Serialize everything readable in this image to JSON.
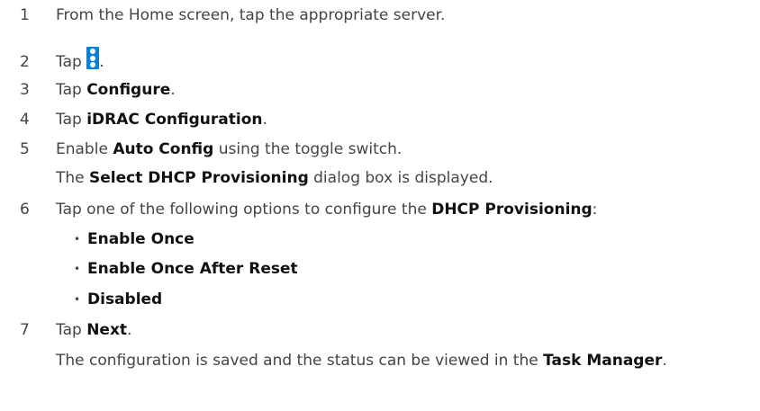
{
  "steps": [
    {
      "num": "1",
      "text": "From the Home screen, tap the appropriate server."
    },
    {
      "num": "2",
      "text_before": "Tap ",
      "icon": "more-options-icon",
      "text_after": "."
    },
    {
      "num": "3",
      "pre": "Tap ",
      "bold": "Configure",
      "post": "."
    },
    {
      "num": "4",
      "pre": "Tap ",
      "bold": "iDRAC Configuration",
      "post": "."
    },
    {
      "num": "5",
      "pre": "Enable ",
      "bold": "Auto Config",
      "post": " using the toggle switch.",
      "note": {
        "pre": "The ",
        "bold": "Select DHCP Provisioning",
        "post": " dialog box is displayed."
      }
    },
    {
      "num": "6",
      "pre": "Tap one of the following options to configure the ",
      "bold": "DHCP Provisioning",
      "post": ":",
      "options": [
        "Enable Once",
        "Enable Once After Reset",
        "Disabled"
      ]
    },
    {
      "num": "7",
      "pre": "Tap ",
      "bold": "Next",
      "post": ".",
      "note": {
        "pre": "The configuration is saved and the status can be viewed in the ",
        "bold": "Task Manager",
        "post": "."
      }
    }
  ],
  "bullet_glyph": "•",
  "icon_color": "#0a7fd0"
}
